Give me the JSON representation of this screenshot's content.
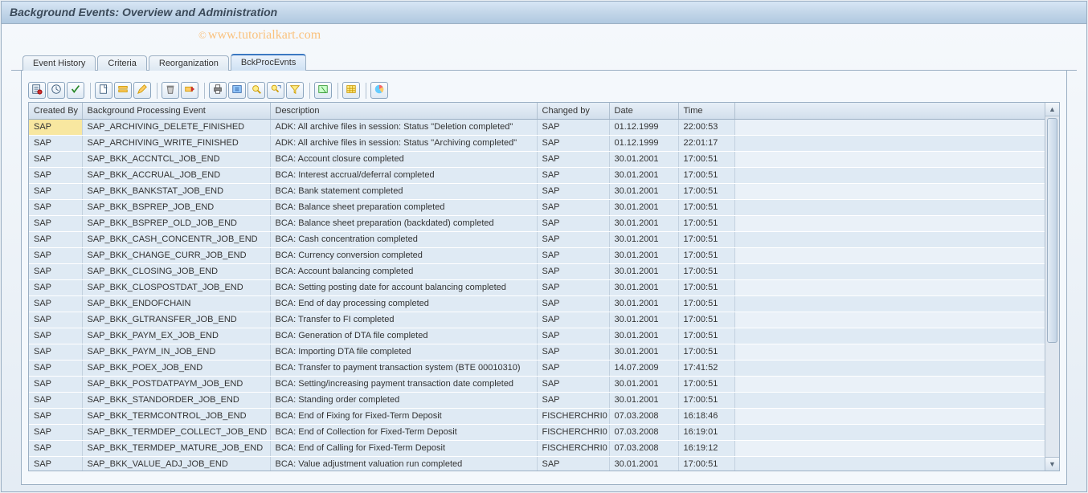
{
  "title": "Background Events: Overview and Administration",
  "watermark": "© www.tutorialkart.com",
  "tabs": [
    {
      "label": "Event History",
      "active": false
    },
    {
      "label": "Criteria",
      "active": false
    },
    {
      "label": "Reorganization",
      "active": false
    },
    {
      "label": "BckProcEvnts",
      "active": true
    }
  ],
  "toolbar_icons": [
    "doc-list",
    "execute",
    "check",
    "sep",
    "doc-new",
    "edit-row",
    "pencil",
    "sep",
    "trash",
    "delete-row",
    "sep",
    "print",
    "export",
    "find",
    "find-next",
    "filter",
    "sep",
    "total",
    "sep",
    "grid",
    "sep",
    "chart"
  ],
  "columns": [
    {
      "key": "createdBy",
      "label": "Created By"
    },
    {
      "key": "event",
      "label": "Background Processing Event"
    },
    {
      "key": "desc",
      "label": "Description"
    },
    {
      "key": "changedBy",
      "label": "Changed by"
    },
    {
      "key": "date",
      "label": "Date"
    },
    {
      "key": "time",
      "label": "Time"
    }
  ],
  "rows": [
    {
      "createdBy": "SAP",
      "event": "SAP_ARCHIVING_DELETE_FINISHED",
      "desc": "ADK: All archive files in session: Status \"Deletion completed\"",
      "changedBy": "SAP",
      "date": "01.12.1999",
      "time": "22:00:53",
      "selected": true
    },
    {
      "createdBy": "SAP",
      "event": "SAP_ARCHIVING_WRITE_FINISHED",
      "desc": "ADK: All archive files in session: Status \"Archiving completed\"",
      "changedBy": "SAP",
      "date": "01.12.1999",
      "time": "22:01:17"
    },
    {
      "createdBy": "SAP",
      "event": "SAP_BKK_ACCNTCL_JOB_END",
      "desc": "BCA: Account closure completed",
      "changedBy": "SAP",
      "date": "30.01.2001",
      "time": "17:00:51"
    },
    {
      "createdBy": "SAP",
      "event": "SAP_BKK_ACCRUAL_JOB_END",
      "desc": "BCA: Interest accrual/deferral completed",
      "changedBy": "SAP",
      "date": "30.01.2001",
      "time": "17:00:51"
    },
    {
      "createdBy": "SAP",
      "event": "SAP_BKK_BANKSTAT_JOB_END",
      "desc": "BCA: Bank statement completed",
      "changedBy": "SAP",
      "date": "30.01.2001",
      "time": "17:00:51"
    },
    {
      "createdBy": "SAP",
      "event": "SAP_BKK_BSPREP_JOB_END",
      "desc": "BCA: Balance sheet preparation completed",
      "changedBy": "SAP",
      "date": "30.01.2001",
      "time": "17:00:51"
    },
    {
      "createdBy": "SAP",
      "event": "SAP_BKK_BSPREP_OLD_JOB_END",
      "desc": "BCA: Balance sheet preparation (backdated) completed",
      "changedBy": "SAP",
      "date": "30.01.2001",
      "time": "17:00:51"
    },
    {
      "createdBy": "SAP",
      "event": "SAP_BKK_CASH_CONCENTR_JOB_END",
      "desc": "BCA: Cash concentration completed",
      "changedBy": "SAP",
      "date": "30.01.2001",
      "time": "17:00:51"
    },
    {
      "createdBy": "SAP",
      "event": "SAP_BKK_CHANGE_CURR_JOB_END",
      "desc": "BCA: Currency conversion completed",
      "changedBy": "SAP",
      "date": "30.01.2001",
      "time": "17:00:51"
    },
    {
      "createdBy": "SAP",
      "event": "SAP_BKK_CLOSING_JOB_END",
      "desc": "BCA: Account balancing completed",
      "changedBy": "SAP",
      "date": "30.01.2001",
      "time": "17:00:51"
    },
    {
      "createdBy": "SAP",
      "event": "SAP_BKK_CLOSPOSTDAT_JOB_END",
      "desc": "BCA: Setting posting date for account balancing completed",
      "changedBy": "SAP",
      "date": "30.01.2001",
      "time": "17:00:51"
    },
    {
      "createdBy": "SAP",
      "event": "SAP_BKK_ENDOFCHAIN",
      "desc": "BCA: End of day processing completed",
      "changedBy": "SAP",
      "date": "30.01.2001",
      "time": "17:00:51"
    },
    {
      "createdBy": "SAP",
      "event": "SAP_BKK_GLTRANSFER_JOB_END",
      "desc": "BCA: Transfer to FI completed",
      "changedBy": "SAP",
      "date": "30.01.2001",
      "time": "17:00:51"
    },
    {
      "createdBy": "SAP",
      "event": "SAP_BKK_PAYM_EX_JOB_END",
      "desc": "BCA: Generation of DTA file completed",
      "changedBy": "SAP",
      "date": "30.01.2001",
      "time": "17:00:51"
    },
    {
      "createdBy": "SAP",
      "event": "SAP_BKK_PAYM_IN_JOB_END",
      "desc": "BCA: Importing DTA file completed",
      "changedBy": "SAP",
      "date": "30.01.2001",
      "time": "17:00:51"
    },
    {
      "createdBy": "SAP",
      "event": "SAP_BKK_POEX_JOB_END",
      "desc": "BCA: Transfer to payment transaction system (BTE 00010310)",
      "changedBy": "SAP",
      "date": "14.07.2009",
      "time": "17:41:52"
    },
    {
      "createdBy": "SAP",
      "event": "SAP_BKK_POSTDATPAYM_JOB_END",
      "desc": "BCA: Setting/increasing payment transaction date completed",
      "changedBy": "SAP",
      "date": "30.01.2001",
      "time": "17:00:51"
    },
    {
      "createdBy": "SAP",
      "event": "SAP_BKK_STANDORDER_JOB_END",
      "desc": "BCA: Standing order completed",
      "changedBy": "SAP",
      "date": "30.01.2001",
      "time": "17:00:51"
    },
    {
      "createdBy": "SAP",
      "event": "SAP_BKK_TERMCONTROL_JOB_END",
      "desc": "BCA: End of Fixing for Fixed-Term Deposit",
      "changedBy": "FISCHERCHRI0",
      "date": "07.03.2008",
      "time": "16:18:46"
    },
    {
      "createdBy": "SAP",
      "event": "SAP_BKK_TERMDEP_COLLECT_JOB_END",
      "desc": "BCA: End of Collection for Fixed-Term Deposit",
      "changedBy": "FISCHERCHRI0",
      "date": "07.03.2008",
      "time": "16:19:01"
    },
    {
      "createdBy": "SAP",
      "event": "SAP_BKK_TERMDEP_MATURE_JOB_END",
      "desc": "BCA: End of Calling for Fixed-Term Deposit",
      "changedBy": "FISCHERCHRI0",
      "date": "07.03.2008",
      "time": "16:19:12"
    },
    {
      "createdBy": "SAP",
      "event": "SAP_BKK_VALUE_ADJ_JOB_END",
      "desc": "BCA: Value adjustment valuation run completed",
      "changedBy": "SAP",
      "date": "30.01.2001",
      "time": "17:00:51"
    }
  ]
}
